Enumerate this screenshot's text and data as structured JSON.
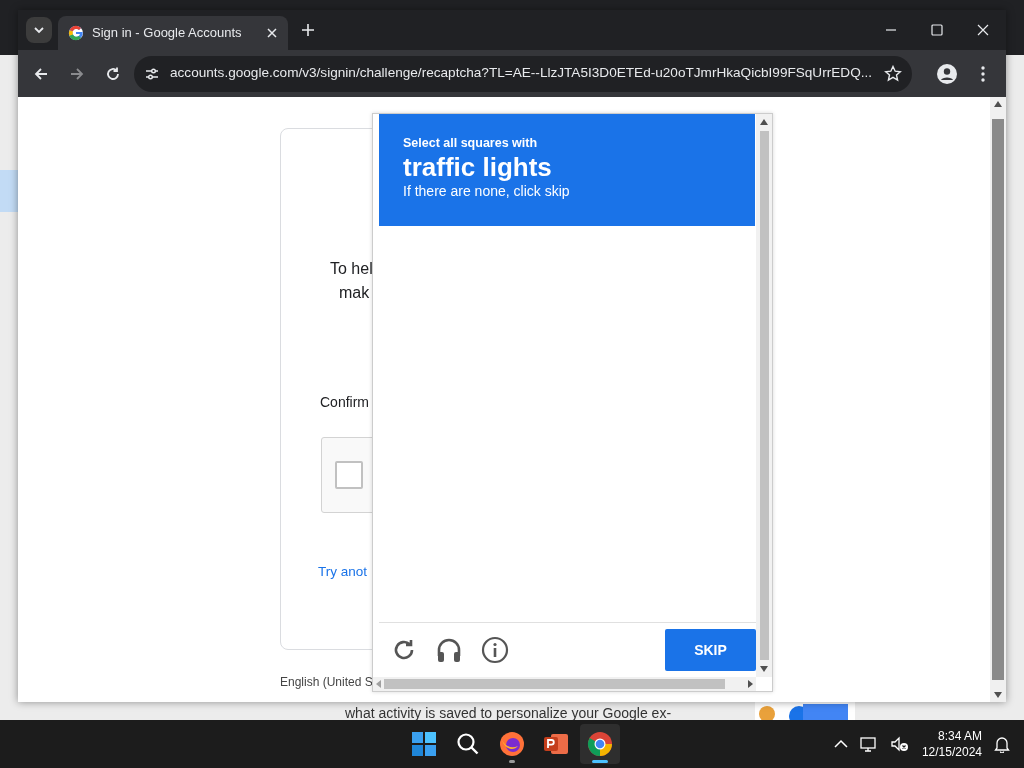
{
  "browser": {
    "tab": {
      "title": "Sign in - Google Accounts",
      "selected": true
    },
    "address": "accounts.google.com/v3/signin/challenge/recaptcha?TL=AE--LlzJTA5I3D0ETEd-u20oTJmrHkaQicbI99FSqUrrEDQ..."
  },
  "page": {
    "card_lines": [
      "To hel",
      "mak"
    ],
    "confirm_label": "Confirm",
    "checkbox_checked": false,
    "link": "Try anot",
    "footer": "English (United S"
  },
  "captcha": {
    "prompt": "Select all squares with",
    "target": "traffic lights",
    "hint": "If there are none, click skip",
    "button": "SKIP"
  },
  "background_page": {
    "text": "what activity is saved to personalize your Google ex-"
  },
  "taskbar": {
    "apps": [
      {
        "kind": "start",
        "selected": false,
        "running": false
      },
      {
        "kind": "search",
        "selected": false,
        "running": false
      },
      {
        "kind": "firefox",
        "selected": false,
        "running": true
      },
      {
        "kind": "powerpoint",
        "selected": false,
        "running": false
      },
      {
        "kind": "chrome",
        "selected": true,
        "running": true
      }
    ],
    "time": "8:34 AM",
    "date": "12/15/2024"
  }
}
